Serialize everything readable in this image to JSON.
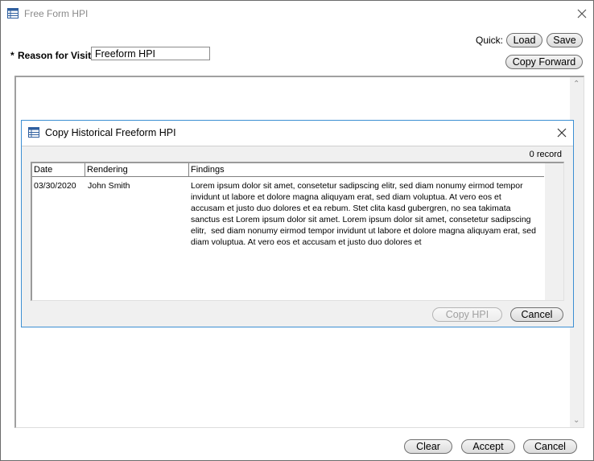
{
  "window": {
    "title": "Free Form HPI"
  },
  "quick": {
    "label": "Quick:",
    "load_label": "Load",
    "save_label": "Save",
    "copy_forward_label": "Copy Forward"
  },
  "reason": {
    "required_mark": "*",
    "label": "Reason for Visit:",
    "value": "Freeform HPI"
  },
  "dialog": {
    "title": "Copy Historical Freeform HPI",
    "record_count": "0 record",
    "columns": [
      "Date",
      "Rendering",
      "Findings"
    ],
    "rows": [
      {
        "date": "03/30/2020",
        "rendering": "John Smith",
        "findings": [
          "Lorem ipsum dolor sit amet, consetetur sadipscing elitr, sed diam nonumy eirmod tempor",
          "invidunt ut labore et dolore magna aliquyam erat, sed diam voluptua. At vero eos et",
          "accusam et justo duo dolores et ea rebum. Stet clita kasd gubergren, no sea takimata",
          "sanctus est Lorem ipsum dolor sit amet. Lorem ipsum dolor sit amet, consetetur sadipscing",
          "elitr,  sed diam nonumy eirmod tempor invidunt ut labore et dolore magna aliquyam erat, sed",
          "diam voluptua. At vero eos et accusam et justo duo dolores et"
        ]
      }
    ],
    "copy_hpi_label": "Copy HPI",
    "cancel_label": "Cancel"
  },
  "footer": {
    "clear_label": "Clear",
    "accept_label": "Accept",
    "cancel_label": "Cancel"
  },
  "icons": {
    "window_icon": "table-icon",
    "close": "close-icon",
    "scroll_up": "chevron-up-icon",
    "scroll_down": "chevron-down-icon"
  },
  "colors": {
    "dialog_border": "#3c8fd3",
    "disabled_text": "#a0a0a0"
  }
}
